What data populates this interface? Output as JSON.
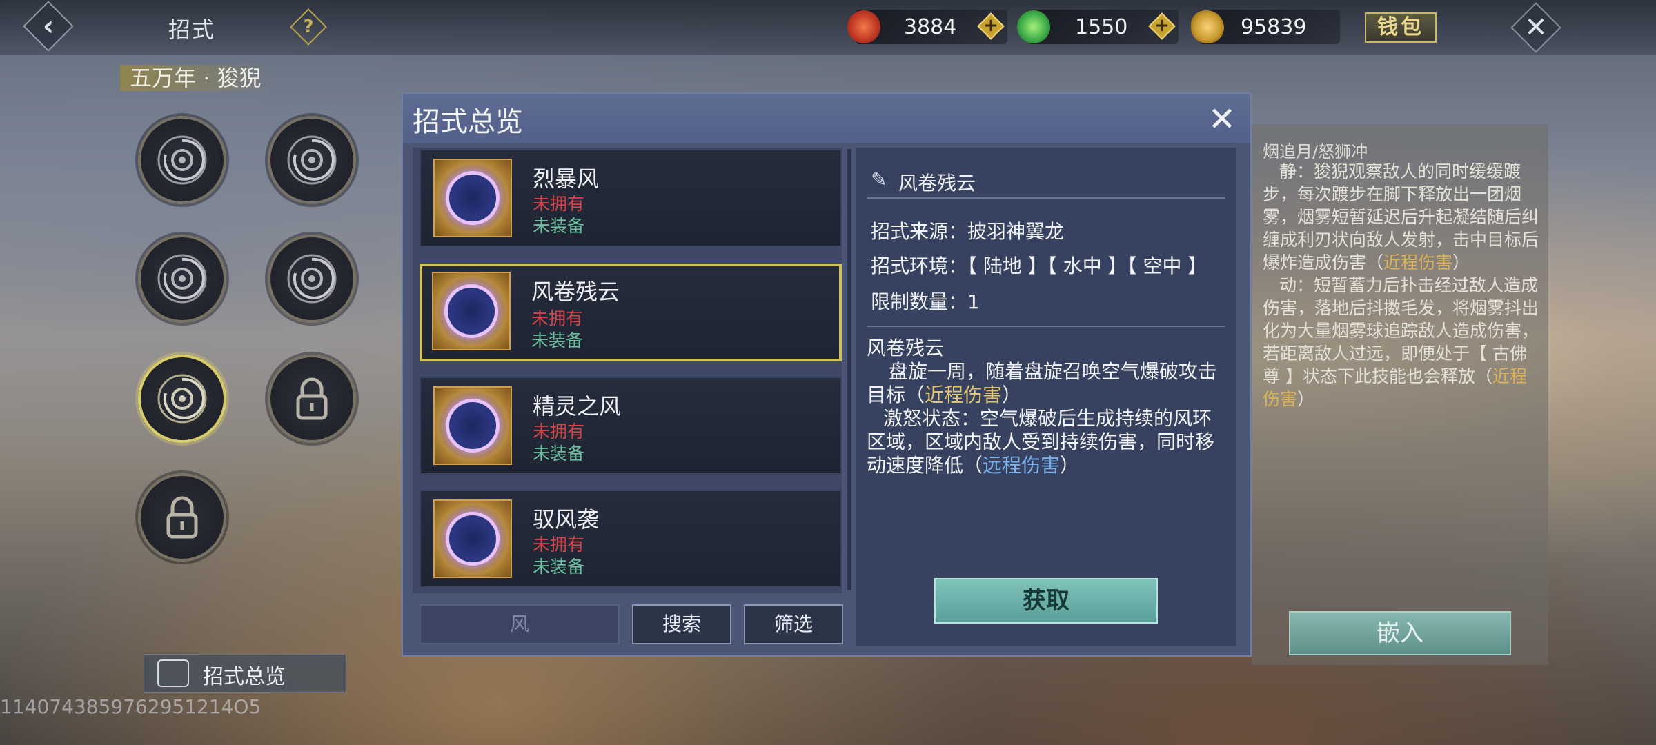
{
  "header": {
    "title": "招式",
    "help_label": "?",
    "currencies": [
      {
        "icon": "red-spiral-coin-icon",
        "value": "3884",
        "color": "#c0392b"
      },
      {
        "icon": "green-jade-coin-icon",
        "value": "1550",
        "color": "#3fae4a"
      },
      {
        "icon": "gold-feather-coin-icon",
        "value": "95839",
        "color": "#c99a2e"
      }
    ],
    "plus_label": "+",
    "wallet_label": "钱包"
  },
  "left": {
    "beast_name": "五万年 · 狻猊",
    "slots": [
      {
        "state": "skill"
      },
      {
        "state": "skill"
      },
      {
        "state": "skill"
      },
      {
        "state": "skill"
      },
      {
        "state": "active"
      },
      {
        "state": "locked"
      },
      {
        "state": "locked"
      }
    ],
    "overview_label": "招式总览",
    "uid": "1140743859762951214O5"
  },
  "dialog": {
    "title": "招式总览",
    "skills": [
      {
        "name": "烈暴风",
        "own": "未拥有",
        "equip": "未装备"
      },
      {
        "name": "风卷残云",
        "own": "未拥有",
        "equip": "未装备",
        "selected": true
      },
      {
        "name": "精灵之风",
        "own": "未拥有",
        "equip": "未装备"
      },
      {
        "name": "驭风袭",
        "own": "未拥有",
        "equip": "未装备"
      }
    ],
    "filter_value": "风",
    "search_label": "搜索",
    "filter_label": "筛选",
    "detail": {
      "name": "风卷残云",
      "source": "招式来源：披羽神翼龙",
      "env": "招式环境：【 陆地 】【 水中 】【 空中 】",
      "limit": "限制数量：1",
      "desc_title": "风卷残云",
      "desc_line1": "盘旋一周，随着盘旋召唤空气爆破攻击目标（",
      "desc_hl1": "近程伤害",
      "desc_close1": "）",
      "desc_line2": "激怒状态：空气爆破后生成持续的风环区域，区域内敌人受到持续伤害，同时移动速度降低（",
      "desc_hl2": "远程伤害",
      "desc_close2": "）",
      "get_label": "获取"
    }
  },
  "side": {
    "title": "烟追月/怒狮冲",
    "p1": "静：狻猊观察敌人的同时缓缓踱步，每次踱步在脚下释放出一团烟雾，烟雾短暂延迟后升起凝结随后纠缠成利刃状向敌人发射，击中目标后爆炸造成伤害（",
    "p1_hl": "近程伤害",
    "p1_close": "）",
    "p2": "动：短暂蓄力后扑击经过敌人造成伤害，落地后抖擞毛发，将烟雾抖出化为大量烟雾球追踪敌人造成伤害，若距离敌人过远，即便处于【 古佛尊 】状态下此技能也会释放（",
    "p2_hl": "近程伤害",
    "p2_close": "）",
    "embed_label": "嵌入"
  }
}
